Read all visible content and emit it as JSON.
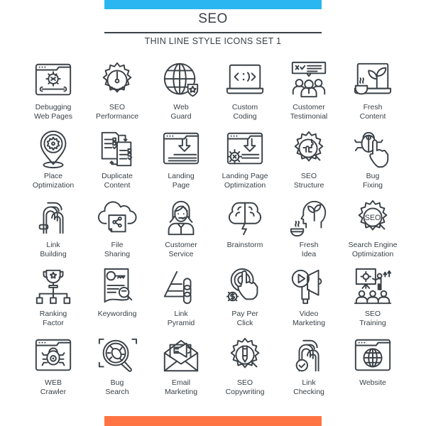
{
  "header": {
    "title": "SEO",
    "subtitle": "THIN LINE STYLE ICONS SET  1",
    "accent_top": "#29b6f1",
    "accent_bottom": "#ff7442",
    "ink": "#3a4147"
  },
  "icons": [
    {
      "icon": "debugging-web-pages-icon",
      "lines": [
        "Debugging",
        "Web Pages"
      ]
    },
    {
      "icon": "seo-performance-icon",
      "lines": [
        "SEO",
        "Performance"
      ]
    },
    {
      "icon": "web-guard-icon",
      "lines": [
        "Web",
        "Guard"
      ]
    },
    {
      "icon": "custom-coding-icon",
      "lines": [
        "Custom",
        "Coding"
      ]
    },
    {
      "icon": "customer-testimonial-icon",
      "lines": [
        "Customer",
        "Testimonial"
      ]
    },
    {
      "icon": "fresh-content-icon",
      "lines": [
        "Fresh",
        "Content"
      ]
    },
    {
      "icon": "place-optimization-icon",
      "lines": [
        "Place",
        "Optimization"
      ]
    },
    {
      "icon": "duplicate-content-icon",
      "lines": [
        "Duplicate",
        "Content"
      ]
    },
    {
      "icon": "landing-page-icon",
      "lines": [
        "Landing",
        "Page"
      ]
    },
    {
      "icon": "landing-page-optimization-icon",
      "lines": [
        "Landing Page",
        "Optimization"
      ]
    },
    {
      "icon": "seo-structure-icon",
      "lines": [
        "SEO",
        "Structure"
      ]
    },
    {
      "icon": "bug-fixing-icon",
      "lines": [
        "Bug",
        "Fixing"
      ]
    },
    {
      "icon": "link-building-icon",
      "lines": [
        "Link",
        "Building"
      ]
    },
    {
      "icon": "file-sharing-icon",
      "lines": [
        "File",
        "Sharing"
      ]
    },
    {
      "icon": "customer-service-icon",
      "lines": [
        "Customer",
        "Service"
      ]
    },
    {
      "icon": "brainstorm-icon",
      "lines": [
        "Brainstorm",
        ""
      ]
    },
    {
      "icon": "fresh-idea-icon",
      "lines": [
        "Fresh",
        "Idea"
      ]
    },
    {
      "icon": "search-engine-optimization-icon",
      "lines": [
        "Search Engine",
        "Optimization"
      ],
      "badge": "SEO"
    },
    {
      "icon": "ranking-factor-icon",
      "lines": [
        "Ranking",
        "Factor"
      ]
    },
    {
      "icon": "keywording-icon",
      "lines": [
        "Keywording",
        ""
      ]
    },
    {
      "icon": "link-pyramid-icon",
      "lines": [
        "Link",
        "Pyramid"
      ]
    },
    {
      "icon": "pay-per-click-icon",
      "lines": [
        "Pay Per",
        "Click"
      ]
    },
    {
      "icon": "video-marketing-icon",
      "lines": [
        "Video",
        "Marketing"
      ]
    },
    {
      "icon": "seo-training-icon",
      "lines": [
        "SEO",
        "Training"
      ]
    },
    {
      "icon": "web-crawler-icon",
      "lines": [
        "WEB",
        "Crawler"
      ]
    },
    {
      "icon": "bug-search-icon",
      "lines": [
        "Bug",
        "Search"
      ]
    },
    {
      "icon": "email-marketing-icon",
      "lines": [
        "Email",
        "Marketing"
      ]
    },
    {
      "icon": "seo-copywriting-icon",
      "lines": [
        "SEO",
        "Copywriting"
      ]
    },
    {
      "icon": "link-checking-icon",
      "lines": [
        "Link",
        "Checking"
      ]
    },
    {
      "icon": "website-icon",
      "lines": [
        "Website",
        ""
      ]
    }
  ]
}
